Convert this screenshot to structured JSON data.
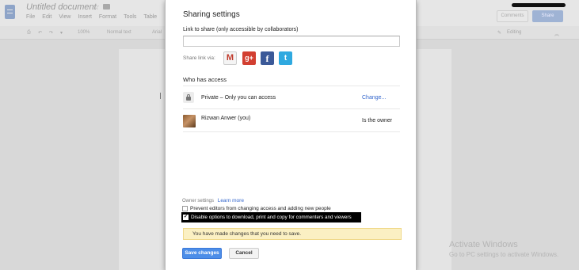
{
  "background": {
    "doc_title": "Untitled document",
    "menu": [
      "File",
      "Edit",
      "View",
      "Insert",
      "Format",
      "Tools",
      "Table"
    ],
    "toolbar": {
      "zoom": "100%",
      "style": "Normal text",
      "font": "Arial",
      "mode": "Editing"
    },
    "comments_label": "Comments",
    "share_label": "Share",
    "activate_title": "Activate Windows",
    "activate_sub": "Go to PC settings to activate Windows."
  },
  "dialog": {
    "title": "Sharing settings",
    "link_label": "Link to share (only accessible by collaborators)",
    "link_value": "",
    "share_via_label": "Share link via:",
    "social": [
      {
        "name": "gmail",
        "glyph": "M",
        "color": "#c0392b"
      },
      {
        "name": "google-plus",
        "glyph": "g+",
        "color": "#d23f31"
      },
      {
        "name": "facebook",
        "glyph": "f",
        "color": "#3b5998"
      },
      {
        "name": "twitter",
        "glyph": "t",
        "color": "#2fa9e0"
      }
    ],
    "who_has_access": "Who has access",
    "private_text": "Private – Only you can access",
    "change_link": "Change...",
    "user_name": "Rizwan Anwer (you)",
    "user_role": "Is the owner",
    "owner_settings": "Owner settings",
    "learn_more": "Learn more",
    "option1": "Prevent editors from changing access and adding new people",
    "option1_checked": false,
    "option2": "Disable options to download, print and copy for commenters and viewers",
    "option2_checked": true,
    "notice": "You have made changes that you need to save.",
    "save_button": "Save changes",
    "cancel_button": "Cancel"
  },
  "colors": {
    "accent": "#4d8ee8",
    "notice_bg": "#fbf0c3",
    "link": "#3366cc"
  }
}
